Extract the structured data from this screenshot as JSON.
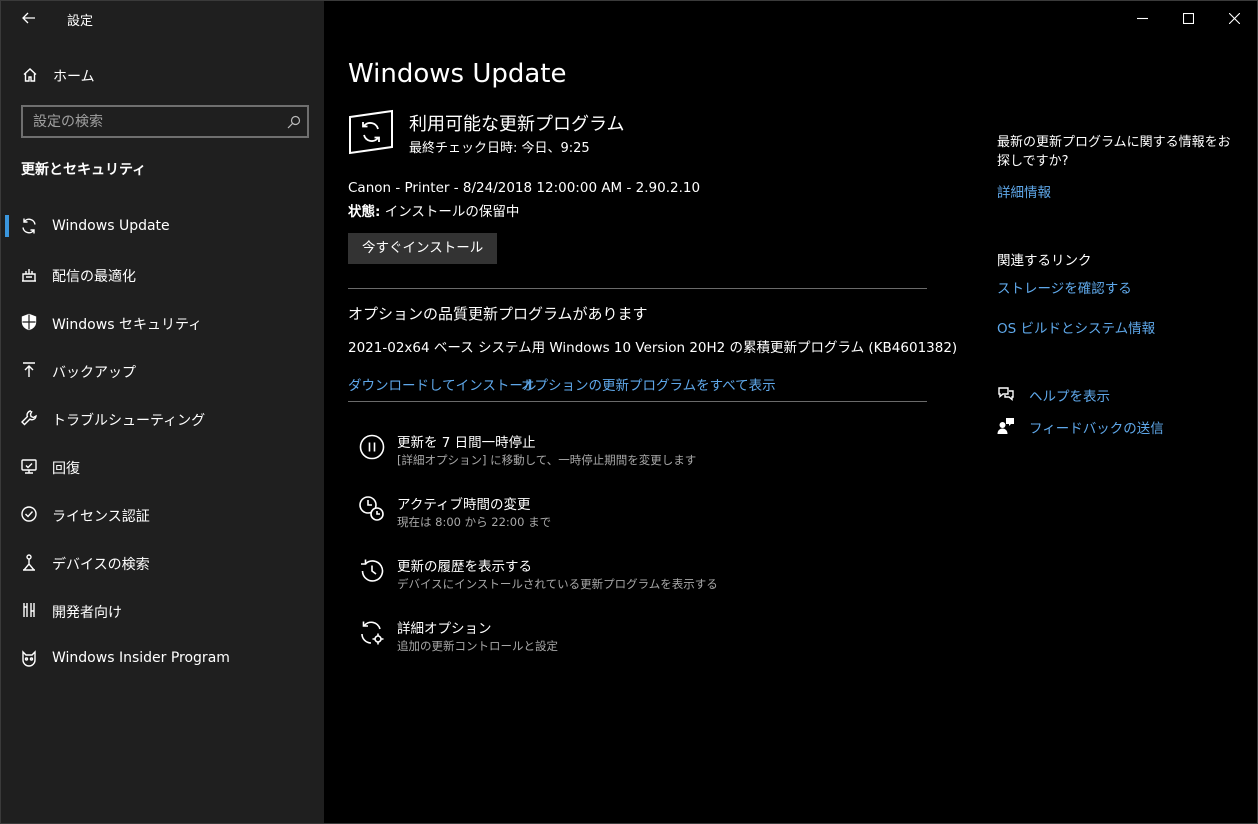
{
  "window": {
    "app_title": "設定",
    "controls": {
      "minimize": "minimize",
      "maximize": "maximize",
      "close": "close"
    }
  },
  "sidebar": {
    "home_label": "ホーム",
    "search_placeholder": "設定の検索",
    "section_heading": "更新とセキュリティ",
    "items": [
      {
        "label": "Windows Update",
        "icon": "sync-icon",
        "active": true
      },
      {
        "label": "配信の最適化",
        "icon": "delivery-optimization-icon"
      },
      {
        "label": "Windows セキュリティ",
        "icon": "shield-icon"
      },
      {
        "label": "バックアップ",
        "icon": "backup-icon"
      },
      {
        "label": "トラブルシューティング",
        "icon": "wrench-icon"
      },
      {
        "label": "回復",
        "icon": "recovery-icon"
      },
      {
        "label": "ライセンス認証",
        "icon": "check-circle-icon"
      },
      {
        "label": "デバイスの検索",
        "icon": "find-device-icon"
      },
      {
        "label": "開発者向け",
        "icon": "developer-icon"
      },
      {
        "label": "Windows Insider Program",
        "icon": "insider-cat-icon"
      }
    ]
  },
  "main": {
    "title": "Windows Update",
    "status_title": "利用可能な更新プログラム",
    "status_sub": "最終チェック日時: 今日、9:25",
    "update_name": "Canon - Printer - 8/24/2018 12:00:00 AM - 2.90.2.10",
    "update_state_label": "状態:",
    "update_state_value": " インストールの保留中",
    "install_button": "今すぐインストール",
    "optional_title": "オプションの品質更新プログラムがあります",
    "optional_desc": "2021-02x64 ベース システム用 Windows 10 Version 20H2 の累積更新プログラム (KB4601382)",
    "optional_link_download": "ダウンロードしてインストール",
    "optional_link_view_all": "オプションの更新プログラムをすべて表示",
    "actions": [
      {
        "title": "更新を 7 日間一時停止",
        "sub": "[詳細オプション] に移動して、一時停止期間を変更します",
        "icon": "pause-icon"
      },
      {
        "title": "アクティブ時間の変更",
        "sub": "現在は 8:00 から 22:00 まで",
        "icon": "active-hours-icon"
      },
      {
        "title": "更新の履歴を表示する",
        "sub": "デバイスにインストールされている更新プログラムを表示する",
        "icon": "history-icon"
      },
      {
        "title": "詳細オプション",
        "sub": "追加の更新コントロールと設定",
        "icon": "advanced-options-icon"
      }
    ]
  },
  "right": {
    "question": "最新の更新プログラムに関する情報をお探しですか?",
    "more_info_link": "詳細情報",
    "related_heading": "関連するリンク",
    "storage_link": "ストレージを確認する",
    "os_build_link": "OS ビルドとシステム情報",
    "help_link": "ヘルプを表示",
    "feedback_link": "フィードバックの送信"
  },
  "colors": {
    "accent": "#3a96dd",
    "link": "#5fa8ea",
    "sidebar_bg": "#1f1f1f",
    "main_bg": "#000000"
  }
}
